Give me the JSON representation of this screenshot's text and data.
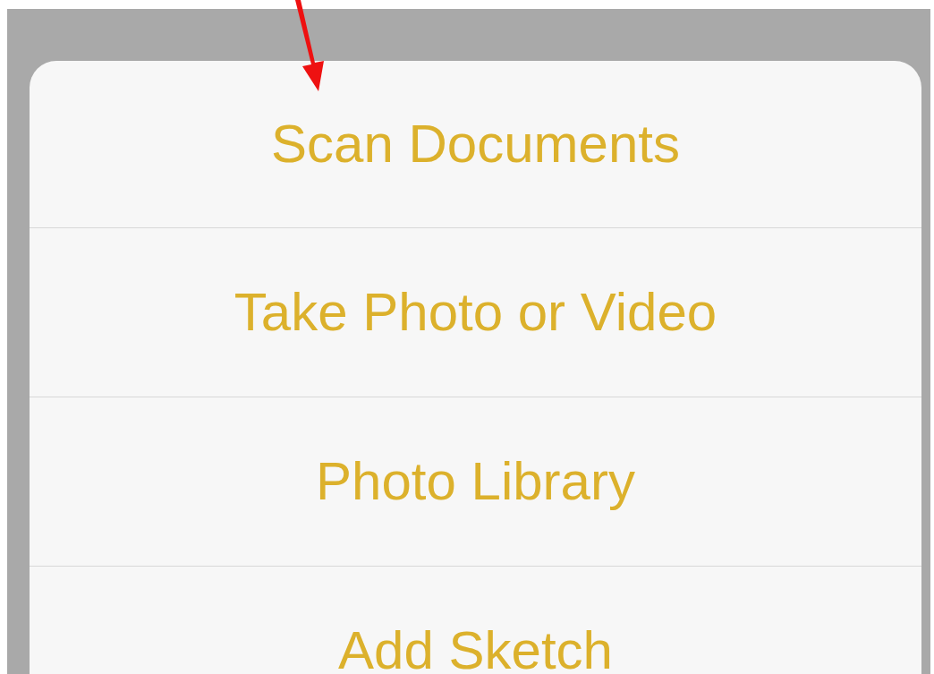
{
  "action_sheet": {
    "items": [
      {
        "label": "Scan Documents"
      },
      {
        "label": "Take Photo or Video"
      },
      {
        "label": "Photo Library"
      },
      {
        "label": "Add Sketch"
      }
    ]
  }
}
